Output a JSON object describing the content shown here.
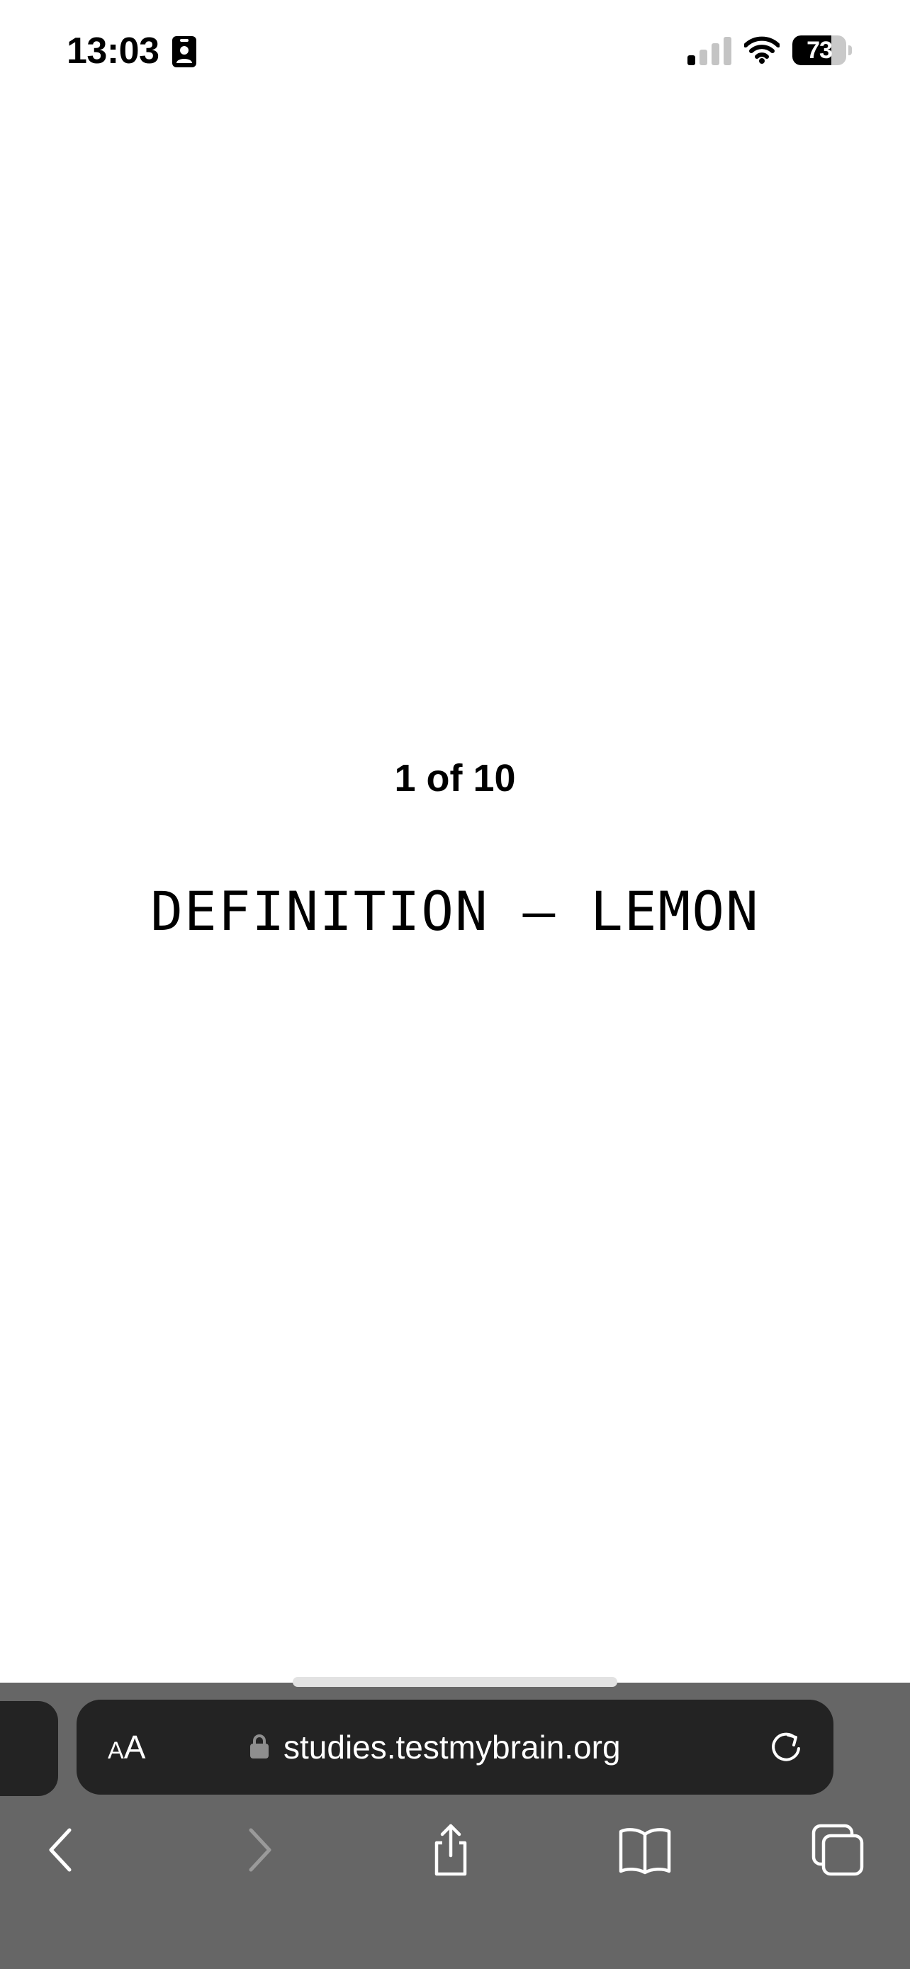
{
  "status_bar": {
    "time": "13:03",
    "battery_percent": "73",
    "battery_level": 0.73,
    "signal_bars_active": 1,
    "signal_bars_total": 4
  },
  "page": {
    "counter": "1 of 10",
    "prompt": "DEFINITION – LEMON"
  },
  "browser": {
    "text_size_small": "A",
    "text_size_big": "A",
    "url": "studies.testmybrain.org",
    "back_enabled": true,
    "forward_enabled": false
  },
  "icons": {
    "focus": "person-badge-icon",
    "signal": "cellular-signal-icon",
    "wifi": "wifi-icon",
    "lock": "lock-icon",
    "reload": "reload-icon",
    "back": "chevron-left-icon",
    "forward": "chevron-right-icon",
    "share": "share-icon",
    "bookmarks": "book-icon",
    "tabs": "tabs-icon"
  },
  "colors": {
    "page_background": "#ffffff",
    "toolbar_background": "#666666",
    "address_pill": "#232323",
    "disabled_icon": "#9a9a9a"
  }
}
